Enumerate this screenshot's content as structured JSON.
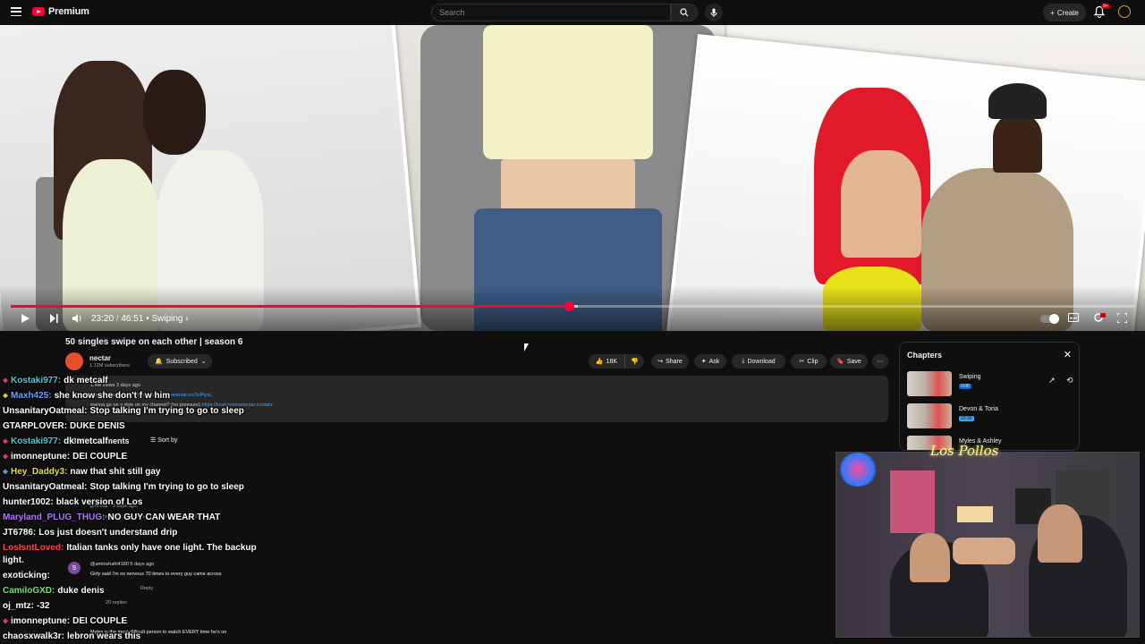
{
  "header": {
    "brand": "Premium",
    "search_placeholder": "Search",
    "create_label": "Create",
    "notification_count": "9+"
  },
  "player": {
    "time_current": "23:20",
    "time_total": "46:51",
    "chapter_label": "Swiping",
    "progress_fraction": 0.497,
    "buffered_fraction": 0.505
  },
  "video": {
    "title": "50 singles swipe on each other | season 6",
    "channel": "nectar",
    "subscribers": "1.12M subscribers",
    "subscribed_label": "Subscribed",
    "likes": "18K",
    "share_label": "Share",
    "ask_label": "Ask",
    "download_label": "Download",
    "clip_label": "Clip",
    "save_label": "Save"
  },
  "description": {
    "meta": "1.4M views  3 days ago",
    "line1_text": "shop my swimwear ",
    "line1_link": "https://lovecommanectar.co/3vPtysL",
    "line2_text": "wanna go on a date on my channel? (no pressure) ",
    "line2_link": "https://lovecommanectar.co/date"
  },
  "comments": {
    "count_label": "2,334 Comments",
    "sort_label": "Sort by",
    "ghost": [
      {
        "text": "@nectar · 3 days ago"
      },
      {
        "text": "shop the looks: https://lovecommanectar.co/4l1T7ou"
      },
      {
        "text": "@aminshahi4180 5 days ago"
      },
      {
        "text": "Girly said I'm so nervous 70 times to every guy came across"
      },
      {
        "text": "Reply"
      },
      {
        "text": "20 replies"
      },
      {
        "text": "Myles is the most difficult person to watch EVERY time he's on"
      }
    ]
  },
  "chat": [
    {
      "user": "Kostaki977:",
      "msg": "dk metcalf",
      "color": "#4ec9e0",
      "badge": "#e03a6a"
    },
    {
      "user": "Maxh425:",
      "msg": "she know she don't f w him",
      "color": "#6ea0ff",
      "badge": "#e0c03a"
    },
    {
      "user": "UnsanitaryOatmeal:",
      "msg": "Stop talking I'm trying to go to sleep",
      "color": "#ffffff",
      "badge": ""
    },
    {
      "user": "GTARPLOVER:",
      "msg": "DUKE DENIS",
      "color": "#ffffff",
      "badge": ""
    },
    {
      "user": "Kostaki977:",
      "msg": "dk metcalf",
      "color": "#4ec9e0",
      "badge": "#e03a6a"
    },
    {
      "user": "imonneptune:",
      "msg": "DEI COUPLE",
      "color": "#ffffff",
      "badge": "#e03a6a"
    },
    {
      "user": "Hey_Daddy3:",
      "msg": "naw that shit still gay",
      "color": "#e8e03a",
      "badge": "#4a9ee0"
    },
    {
      "user": "UnsanitaryOatmeal:",
      "msg": "Stop talking I'm trying to go to sleep",
      "color": "#ffffff",
      "badge": ""
    },
    {
      "user": "hunter1002:",
      "msg": "black version of Los",
      "color": "#ffffff",
      "badge": ""
    },
    {
      "user": "Maryland_PLUG_THUG:",
      "msg": "NO GUY CAN WEAR THAT",
      "color": "#b276ff",
      "badge": ""
    },
    {
      "user": "JT6786:",
      "msg": "Los just doesn't understand drip",
      "color": "#ffffff",
      "badge": ""
    },
    {
      "user": "LosIsntLoved:",
      "msg": "Italian tanks only have one light. The backup",
      "color": "#ff4a4a",
      "badge": ""
    },
    {
      "user": "",
      "msg": "light.",
      "color": "#ffffff",
      "badge": ""
    },
    {
      "user": "exoticking:",
      "msg": "",
      "color": "#ffffff",
      "badge": ""
    },
    {
      "user": "CamiloGXD:",
      "msg": "duke denis",
      "color": "#7ae07a",
      "badge": ""
    },
    {
      "user": "oj_mtz:",
      "msg": "-32",
      "color": "#ffffff",
      "badge": ""
    },
    {
      "user": "imonneptune:",
      "msg": "DEI COUPLE",
      "color": "#ffffff",
      "badge": "#e03a6a"
    },
    {
      "user": "chaosxwalk3r:",
      "msg": "lebron wears this",
      "color": "#ffffff",
      "badge": ""
    }
  ],
  "chapters": {
    "title": "Chapters",
    "items": [
      {
        "name": "Swiping",
        "time": "0:00"
      },
      {
        "name": "Devon & Toria",
        "time": "23:20"
      },
      {
        "name": "Myles & Ashley",
        "time": ""
      }
    ]
  },
  "webcam": {
    "neon_sign": "Los Pollos"
  },
  "colors": {
    "accent": "#ff0033",
    "link": "#3ea6ff"
  }
}
